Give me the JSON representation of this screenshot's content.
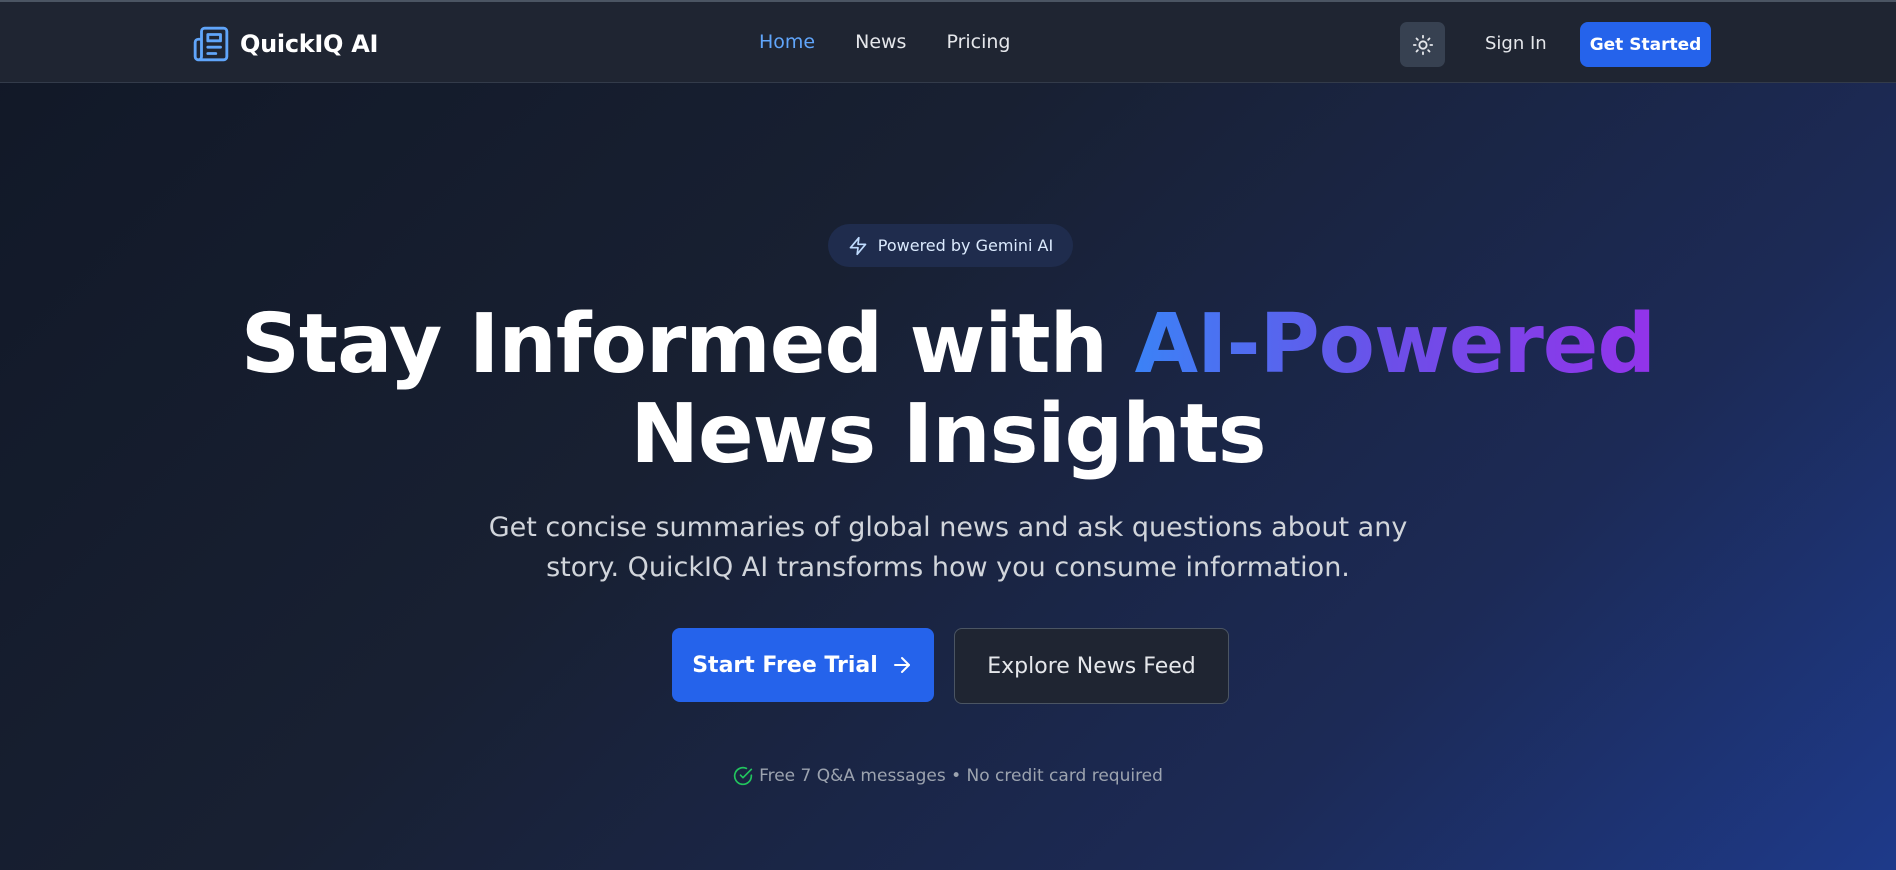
{
  "header": {
    "brand_name": "QuickIQ AI",
    "nav": [
      {
        "label": "Home",
        "active": true
      },
      {
        "label": "News",
        "active": false
      },
      {
        "label": "Pricing",
        "active": false
      }
    ],
    "theme_icon": "sun-icon",
    "sign_in_label": "Sign In",
    "get_started_label": "Get Started"
  },
  "hero": {
    "badge_icon": "lightning-icon",
    "badge_text": "Powered by Gemini AI",
    "headline_part1": "Stay Informed with ",
    "headline_highlight": "AI-Powered",
    "headline_line2": "News Insights",
    "subtitle": "Get concise summaries of global news and ask questions about any story. QuickIQ AI transforms how you consume information.",
    "primary_cta_label": "Start Free Trial",
    "primary_cta_icon": "arrow-right-icon",
    "secondary_cta_label": "Explore News Feed",
    "note_icon": "check-circle-icon",
    "note_text": "Free 7 Q&A messages • No credit card required"
  },
  "colors": {
    "accent": "#2563eb",
    "nav_active": "#60a5fa",
    "gradient_start": "#3b82f6",
    "gradient_end": "#9333ea",
    "success": "#22c55e"
  }
}
